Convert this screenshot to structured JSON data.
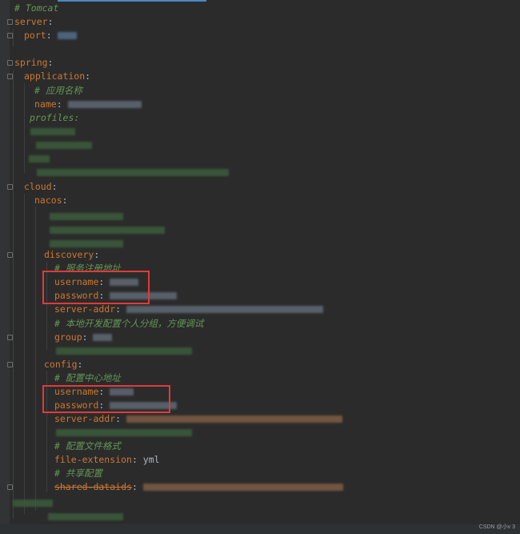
{
  "editor": {
    "lines": {
      "tomcat_comment": "# Tomcat",
      "server": "server",
      "port": "port",
      "spring": "spring",
      "application": "application",
      "app_name_comment": "# 应用名称",
      "name": "name",
      "profiles": "profiles:",
      "cloud": "cloud",
      "nacos": "nacos",
      "discovery": "discovery",
      "discovery_comment": "# 服务注册地址",
      "disc_username": "username",
      "disc_password": "password",
      "disc_server_addr": "server-addr",
      "group_comment": "# 本地开发配置个人分组，方便调试",
      "group": "group",
      "config": "config",
      "config_comment": "# 配置中心地址",
      "conf_username": "username",
      "conf_password": "password",
      "conf_server_addr": "server-addr",
      "file_ext_comment": "# 配置文件格式",
      "file_extension": "file-extension",
      "file_extension_value": "yml",
      "shared_comment": "# 共享配置",
      "shared_dataids": "shared-dataids"
    }
  },
  "watermark": "CSDN @小v 3",
  "colors": {
    "background": "#2b2b2b",
    "key": "#cc7832",
    "comment": "#629755",
    "highlight_box": "#e13a3a"
  }
}
